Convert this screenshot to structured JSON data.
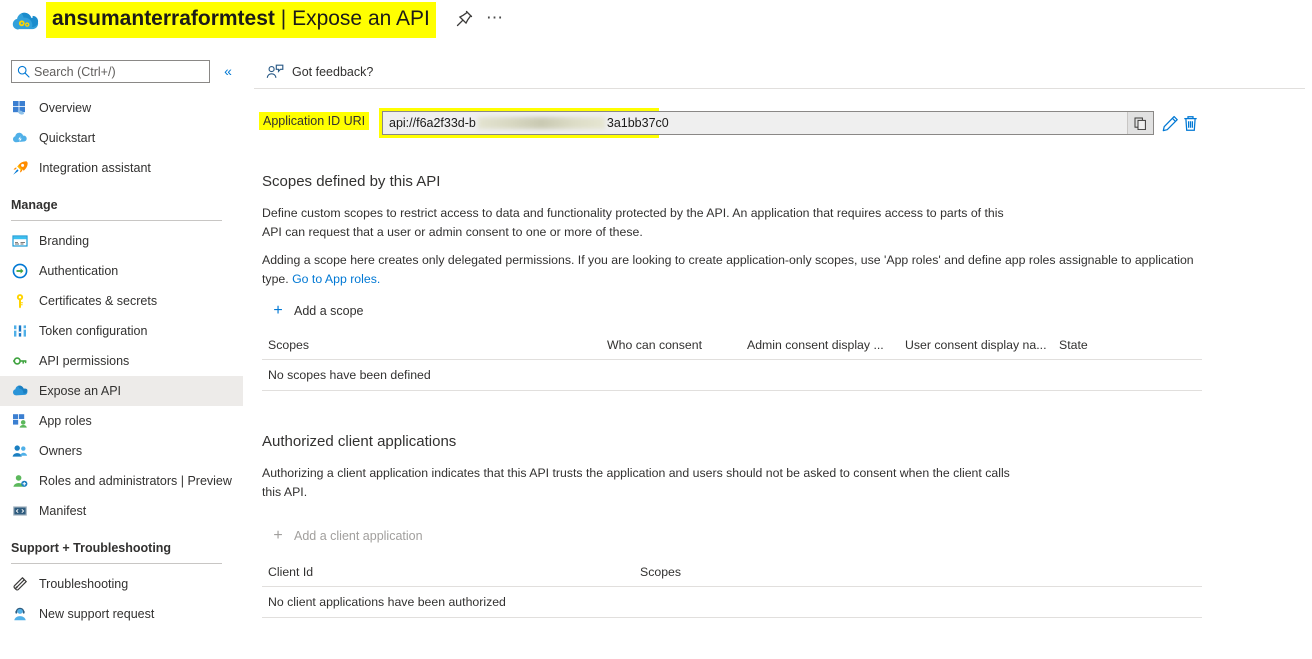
{
  "header": {
    "app_icon": "app-registration-cloud-gear-icon",
    "resource_name": "ansumanterraformtest",
    "separator": "|",
    "blade_name": "Expose an API",
    "pin_icon": "pin-icon",
    "more_icon": "ellipsis-icon",
    "highlight_color": "#ffff00"
  },
  "sidebar": {
    "search": {
      "placeholder": "Search (Ctrl+/)",
      "value": "",
      "icon": "search-icon"
    },
    "collapse_icon": "chevron-double-left-icon",
    "top_items": [
      {
        "label": "Overview",
        "icon": "overview-grid-icon",
        "selected": false
      },
      {
        "label": "Quickstart",
        "icon": "quickstart-cloud-icon",
        "selected": false
      },
      {
        "label": "Integration assistant",
        "icon": "rocket-icon",
        "selected": false
      }
    ],
    "groups": [
      {
        "title": "Manage",
        "items": [
          {
            "label": "Branding",
            "icon": "branding-icon",
            "selected": false
          },
          {
            "label": "Authentication",
            "icon": "authentication-icon",
            "selected": false
          },
          {
            "label": "Certificates & secrets",
            "icon": "key-icon",
            "selected": false
          },
          {
            "label": "Token configuration",
            "icon": "token-bars-icon",
            "selected": false
          },
          {
            "label": "API permissions",
            "icon": "api-permissions-icon",
            "selected": false
          },
          {
            "label": "Expose an API",
            "icon": "expose-api-cloud-icon",
            "selected": true
          },
          {
            "label": "App roles",
            "icon": "app-roles-icon",
            "selected": false
          },
          {
            "label": "Owners",
            "icon": "owners-people-icon",
            "selected": false
          },
          {
            "label": "Roles and administrators | Preview",
            "icon": "roles-admin-icon",
            "selected": false
          },
          {
            "label": "Manifest",
            "icon": "manifest-code-icon",
            "selected": false
          }
        ]
      },
      {
        "title": "Support + Troubleshooting",
        "items": [
          {
            "label": "Troubleshooting",
            "icon": "wrench-troubleshoot-icon",
            "selected": false
          },
          {
            "label": "New support request",
            "icon": "support-agent-icon",
            "selected": false
          }
        ]
      }
    ]
  },
  "command_bar": {
    "feedback_label": "Got feedback?",
    "feedback_icon": "feedback-person-icon"
  },
  "app_id_uri": {
    "label": "Application ID URI",
    "value_prefix": "api://f6a2f33d-b",
    "value_redacted": "[redacted]",
    "value_suffix": "3a1bb37c0",
    "copy_icon": "copy-icon",
    "edit_icon": "pencil-edit-icon",
    "delete_icon": "trash-delete-icon",
    "highlighted": true
  },
  "scopes_section": {
    "title": "Scopes defined by this API",
    "paragraph1": "Define custom scopes to restrict access to data and functionality protected by the API. An application that requires access to parts of this API can request that a user or admin consent to one or more of these.",
    "paragraph2_before": "Adding a scope here creates only delegated permissions. If you are looking to create application-only scopes, use 'App roles' and define app roles assignable to application type.",
    "paragraph2_link": "Go to App roles.",
    "add_label": "Add a scope",
    "add_icon": "plus-icon",
    "columns": [
      "Scopes",
      "Who can consent",
      "Admin consent display ...",
      "User consent display na...",
      "State"
    ],
    "empty_message": "No scopes have been defined"
  },
  "authorized_clients_section": {
    "title": "Authorized client applications",
    "paragraph": "Authorizing a client application indicates that this API trusts the application and users should not be asked to consent when the client calls this API.",
    "add_label": "Add a client application",
    "add_icon": "plus-icon",
    "add_disabled": true,
    "columns": [
      "Client Id",
      "Scopes"
    ],
    "empty_message": "No client applications have been authorized"
  }
}
